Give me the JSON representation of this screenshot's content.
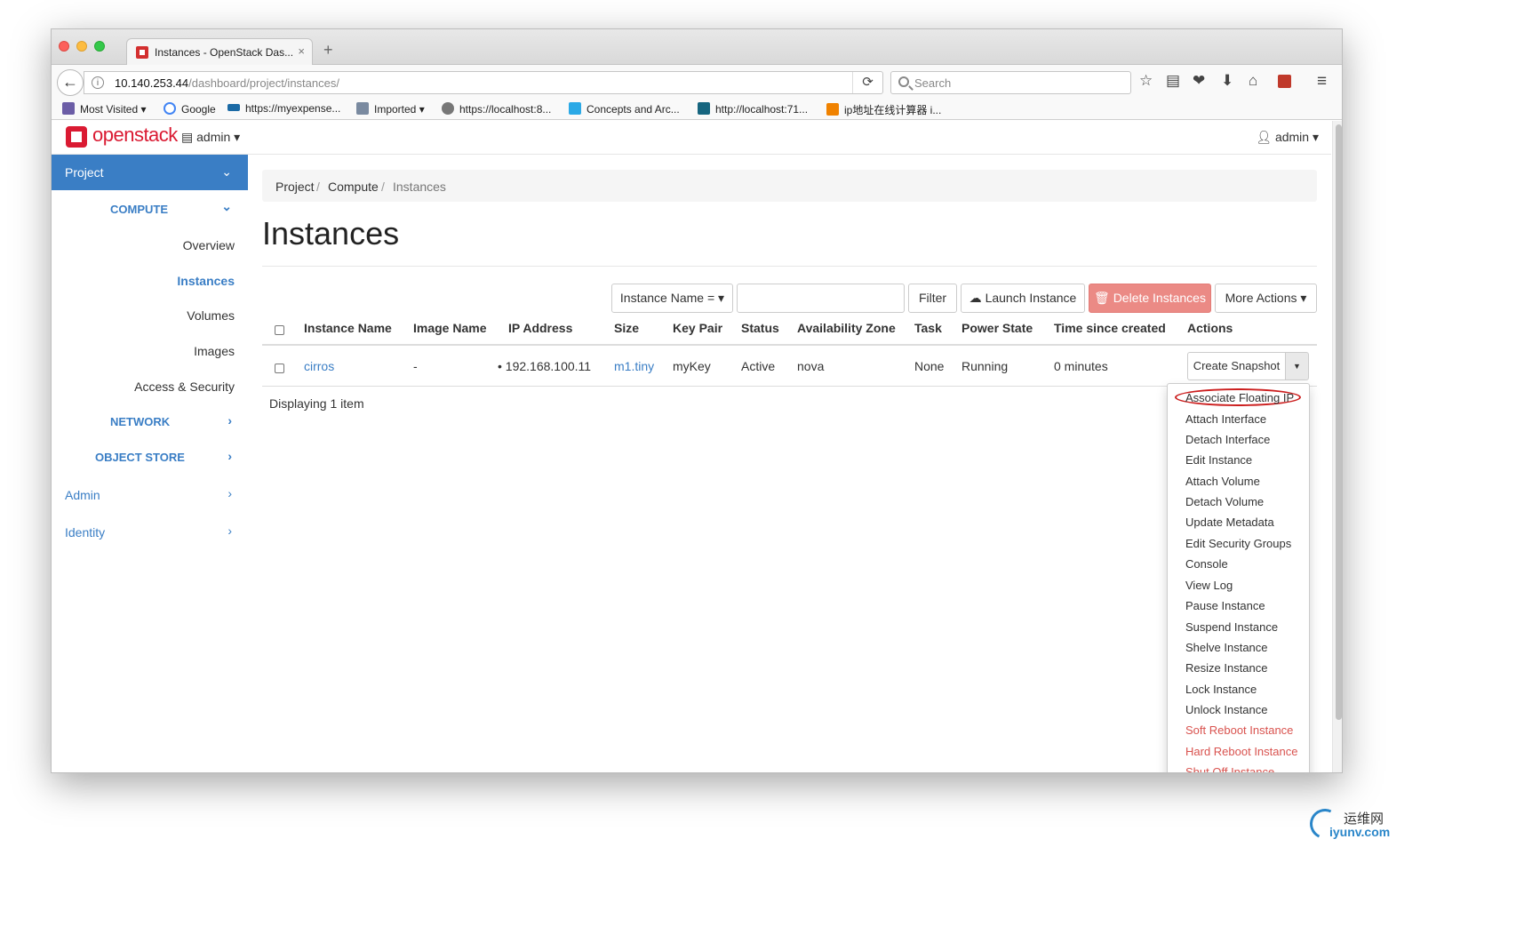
{
  "browser": {
    "tab_title": "Instances - OpenStack Das...",
    "tab_close": "×",
    "new_tab": "+",
    "url_host": "10.140.253.44",
    "url_path": "/dashboard/project/instances/",
    "search_placeholder": "Search",
    "bookmarks": [
      {
        "label": "Most Visited ▾",
        "icon_color": "#6b5da6"
      },
      {
        "label": "Google",
        "icon_color": "#4285f4"
      },
      {
        "label": "https://myexpense...",
        "icon_color": "#1b6aa5"
      },
      {
        "label": "Imported ▾",
        "icon_color": "#7a8aa0"
      },
      {
        "label": "https://localhost:8...",
        "icon_color": "#777777"
      },
      {
        "label": "Concepts and Arc...",
        "icon_color": "#2ba9e6"
      },
      {
        "label": "http://localhost:71...",
        "icon_color": "#16657f"
      },
      {
        "label": "ip地址在线计算器 i...",
        "icon_color": "#f08200"
      }
    ]
  },
  "header": {
    "logo": "openstack",
    "project_selector": "admin ▾",
    "user_menu": "admin ▾"
  },
  "sidebar": {
    "project": "Project",
    "compute": "COMPUTE",
    "items": [
      "Overview",
      "Instances",
      "Volumes",
      "Images",
      "Access & Security"
    ],
    "network": "NETWORK",
    "object_store": "OBJECT STORE",
    "admin": "Admin",
    "identity": "Identity"
  },
  "breadcrumb": [
    "Project",
    "Compute",
    "Instances"
  ],
  "page_title": "Instances",
  "toolbar": {
    "filter_field": "Instance Name = ▾",
    "filter_button": "Filter",
    "launch": "Launch Instance",
    "delete": "Delete Instances",
    "more": "More Actions ▾"
  },
  "table": {
    "headers": [
      "Instance Name",
      "Image Name",
      "IP Address",
      "Size",
      "Key Pair",
      "Status",
      "Availability Zone",
      "Task",
      "Power State",
      "Time since created",
      "Actions"
    ],
    "rows": [
      {
        "instance_name": "cirros",
        "image_name": "-",
        "ip_address": "192.168.100.11",
        "size": "m1.tiny",
        "key_pair": "myKey",
        "status": "Active",
        "availability_zone": "nova",
        "task": "None",
        "power_state": "Running",
        "time_since_created": "0 minutes",
        "action": "Create Snapshot"
      }
    ],
    "footer": "Displaying 1 item"
  },
  "actions_menu": [
    {
      "label": "Associate Floating IP",
      "danger": false,
      "highlighted": true
    },
    {
      "label": "Attach Interface",
      "danger": false
    },
    {
      "label": "Detach Interface",
      "danger": false
    },
    {
      "label": "Edit Instance",
      "danger": false
    },
    {
      "label": "Attach Volume",
      "danger": false
    },
    {
      "label": "Detach Volume",
      "danger": false
    },
    {
      "label": "Update Metadata",
      "danger": false
    },
    {
      "label": "Edit Security Groups",
      "danger": false
    },
    {
      "label": "Console",
      "danger": false
    },
    {
      "label": "View Log",
      "danger": false
    },
    {
      "label": "Pause Instance",
      "danger": false
    },
    {
      "label": "Suspend Instance",
      "danger": false
    },
    {
      "label": "Shelve Instance",
      "danger": false
    },
    {
      "label": "Resize Instance",
      "danger": false
    },
    {
      "label": "Lock Instance",
      "danger": false
    },
    {
      "label": "Unlock Instance",
      "danger": false
    },
    {
      "label": "Soft Reboot Instance",
      "danger": true
    },
    {
      "label": "Hard Reboot Instance",
      "danger": true
    },
    {
      "label": "Shut Off Instance",
      "danger": true
    }
  ],
  "watermark": {
    "cn": "运维网",
    "en": "iyunv.com"
  },
  "colors": {
    "accent": "#3a7ec5",
    "danger": "#d9534f",
    "brand": "#da1a32"
  }
}
